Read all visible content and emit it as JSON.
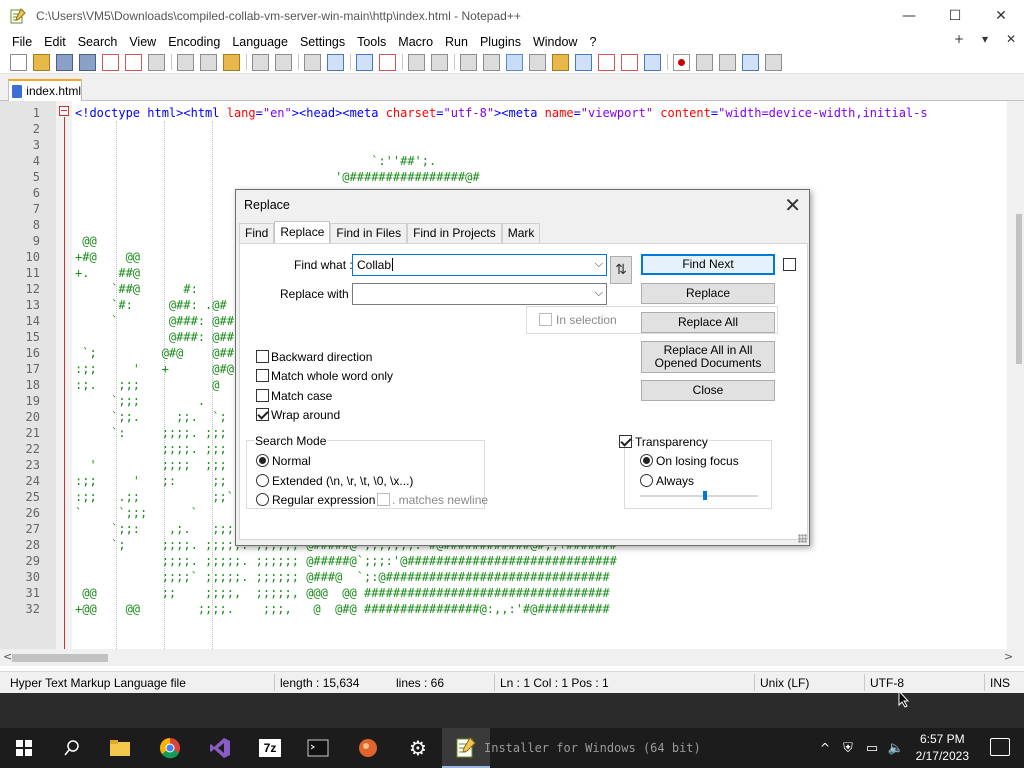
{
  "window": {
    "title": "C:\\Users\\VM5\\Downloads\\compiled-collab-vm-server-win-main\\http\\index.html - Notepad++",
    "minimize": "—",
    "maximize": "☐",
    "close": "✕"
  },
  "menu": {
    "items": [
      "File",
      "Edit",
      "Search",
      "View",
      "Encoding",
      "Language",
      "Settings",
      "Tools",
      "Macro",
      "Run",
      "Plugins",
      "Window",
      "?"
    ],
    "plus": "+",
    "down": "▾",
    "x": "✕"
  },
  "tab": {
    "label": "index.html"
  },
  "editor": {
    "lines": [
      {
        "n": "1",
        "html": "<span class=\"c-tag\">&lt;!doctype html&gt;&lt;html </span><span class=\"c-attr\">lang</span><span class=\"c-tag\">=</span><span class=\"c-str\">\"en\"</span><span class=\"c-tag\">&gt;&lt;head&gt;&lt;meta </span><span class=\"c-attr\">charset</span><span class=\"c-tag\">=</span><span class=\"c-str\">\"utf-8\"</span><span class=\"c-tag\">&gt;&lt;meta </span><span class=\"c-attr\">name</span><span class=\"c-tag\">=</span><span class=\"c-str\">\"viewport\"</span><span class=\"c-tag\"> </span><span class=\"c-attr\">content</span><span class=\"c-tag\">=</span><span class=\"c-str\">\"width=device-width,initial-s</span>"
      },
      {
        "n": "2",
        "text": ""
      },
      {
        "n": "3",
        "text": ""
      },
      {
        "n": "4",
        "text": "                                         `:''##';."
      },
      {
        "n": "5",
        "text": "                                    '@################@#"
      },
      {
        "n": "6",
        "text": ""
      },
      {
        "n": "7",
        "text": ""
      },
      {
        "n": "8",
        "text": ""
      },
      {
        "n": "9",
        "text": " @@"
      },
      {
        "n": "10",
        "text": "+#@    @@"
      },
      {
        "n": "11",
        "text": "+.    ##@"
      },
      {
        "n": "12",
        "text": "     `##@      #:"
      },
      {
        "n": "13",
        "text": "     `#:     @##: .@#"
      },
      {
        "n": "14",
        "text": "     `       @###: @##"
      },
      {
        "n": "15",
        "text": "             @###: @##"
      },
      {
        "n": "16",
        "text": " `;         @#@    @##"
      },
      {
        "n": "17",
        "text": ":;;     '   +      @#@"
      },
      {
        "n": "18",
        "text": ":;.   ;;;          @"
      },
      {
        "n": "19",
        "text": "     `;;;        ."
      },
      {
        "n": "20",
        "text": "     `;;.     ;;.  `;"
      },
      {
        "n": "21",
        "text": "     `:     ;;;;. ;;;"
      },
      {
        "n": "22",
        "text": "            ;;;;. ;;;"
      },
      {
        "n": "23",
        "text": "  '         ;;;;  ;;;"
      },
      {
        "n": "24",
        "text": ":;;     '   ;:     ;;"
      },
      {
        "n": "25",
        "text": ":;;   .;;          ;;`"
      },
      {
        "n": "26",
        "text": "`     `;;;      `"
      },
      {
        "n": "27",
        "text": "     `;;:    ,;.   ;;;.   ;;;; @#####@`;;;;;;;;;;;####@;;;;;;;;;;;+#######"
      },
      {
        "n": "28",
        "text": "     `;     ;;;;. ;;;;;. ;;;;;; @#####@`;;;;;;;:'#@############@#;;+#######"
      },
      {
        "n": "29",
        "text": "            ;;;;. ;;;;;. ;;;;;; @#####@`;;;:'@#############################"
      },
      {
        "n": "30",
        "text": "            ;;;;` ;;;;;. ;;;;;; @###@  `;:@###############################"
      },
      {
        "n": "31",
        "text": " @@         ;;    ;;;;,  ;;;;;, @@@  @@ ##################################"
      },
      {
        "n": "32",
        "text": "+@@    @@        ;;;;.    ;;;,   @  @#@ ################@:,,:'#@##########"
      }
    ]
  },
  "status": {
    "file_type": "Hyper Text Markup Language file",
    "length": "length : 15,634",
    "lines": "lines : 66",
    "position": "Ln : 1    Col : 1    Pos : 1",
    "eol": "Unix (LF)",
    "encoding": "UTF-8",
    "mode": "INS"
  },
  "dialog": {
    "title": "Replace",
    "close": "✕",
    "tabs": [
      "Find",
      "Replace",
      "Find in Files",
      "Find in Projects",
      "Mark"
    ],
    "active_tab": "Replace",
    "find_what_label": "Find what :",
    "find_what_value": "Collab",
    "replace_with_label": "Replace with :",
    "replace_with_value": "",
    "swap_icon": "⇅",
    "in_selection": "In selection",
    "buttons": {
      "find_next": "Find Next",
      "replace": "Replace",
      "replace_all": "Replace All",
      "replace_all_opened": "Replace All in All Opened Documents",
      "close": "Close"
    },
    "options": {
      "backward": "Backward direction",
      "whole_word": "Match whole word only",
      "match_case": "Match case",
      "wrap_around": "Wrap around"
    },
    "search_mode": {
      "label": "Search Mode",
      "normal": "Normal",
      "extended": "Extended (\\n, \\r, \\t, \\0, \\x...)",
      "regex": "Regular expression",
      "matches_newline": ". matches newline"
    },
    "transparency": {
      "label": "Transparency",
      "on_losing_focus": "On losing focus",
      "always": "Always",
      "level": 0.55
    }
  },
  "background_window": {
    "task_text": "Installer for Windows (64 bit)"
  },
  "taskbar": {
    "time": "6:57 PM",
    "date": "2/17/2023",
    "seven_zip": "7z"
  }
}
